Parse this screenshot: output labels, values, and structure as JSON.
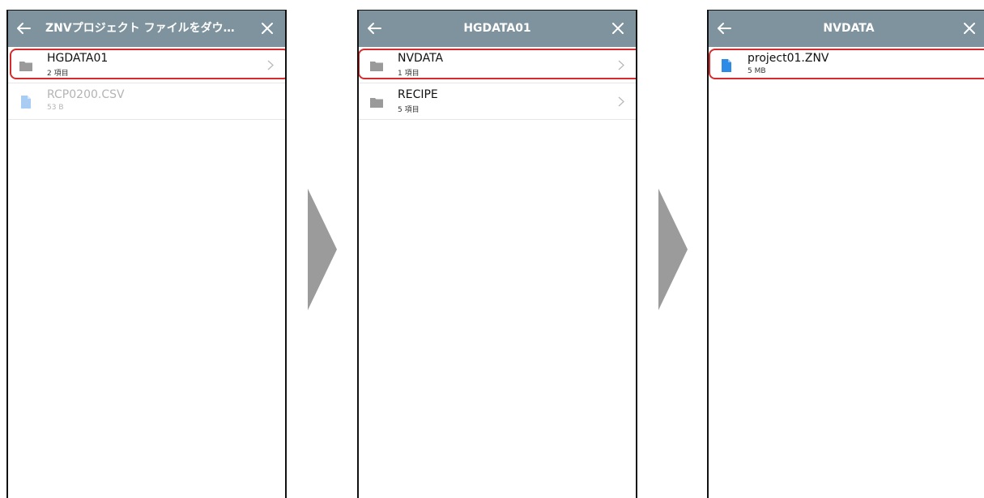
{
  "screens": [
    {
      "title": "ZNVプロジェクト ファイルをダウ…",
      "items": [
        {
          "name": "HGDATA01",
          "meta": "2 項目"
        },
        {
          "name": "RCP0200.CSV",
          "meta": "53 B"
        }
      ]
    },
    {
      "title": "HGDATA01",
      "items": [
        {
          "name": "NVDATA",
          "meta": "1 項目"
        },
        {
          "name": "RECIPE",
          "meta": "5 項目"
        }
      ]
    },
    {
      "title": "NVDATA",
      "items": [
        {
          "name": "project01.ZNV",
          "meta": "5 MB"
        }
      ]
    }
  ],
  "colors": {
    "header": "#7e939e",
    "highlight": "#d42c2c",
    "folder_icon": "#9a9a9a",
    "file_icon": "#2c8be6",
    "file_icon_dimmed": "#a9cdf2",
    "step_arrow": "#9b9b9b"
  },
  "icons": {
    "back": "arrow-left-icon",
    "close": "close-icon",
    "folder": "folder-icon",
    "file": "file-icon",
    "chevron": "chevron-right-icon",
    "step": "step-arrow-icon"
  }
}
